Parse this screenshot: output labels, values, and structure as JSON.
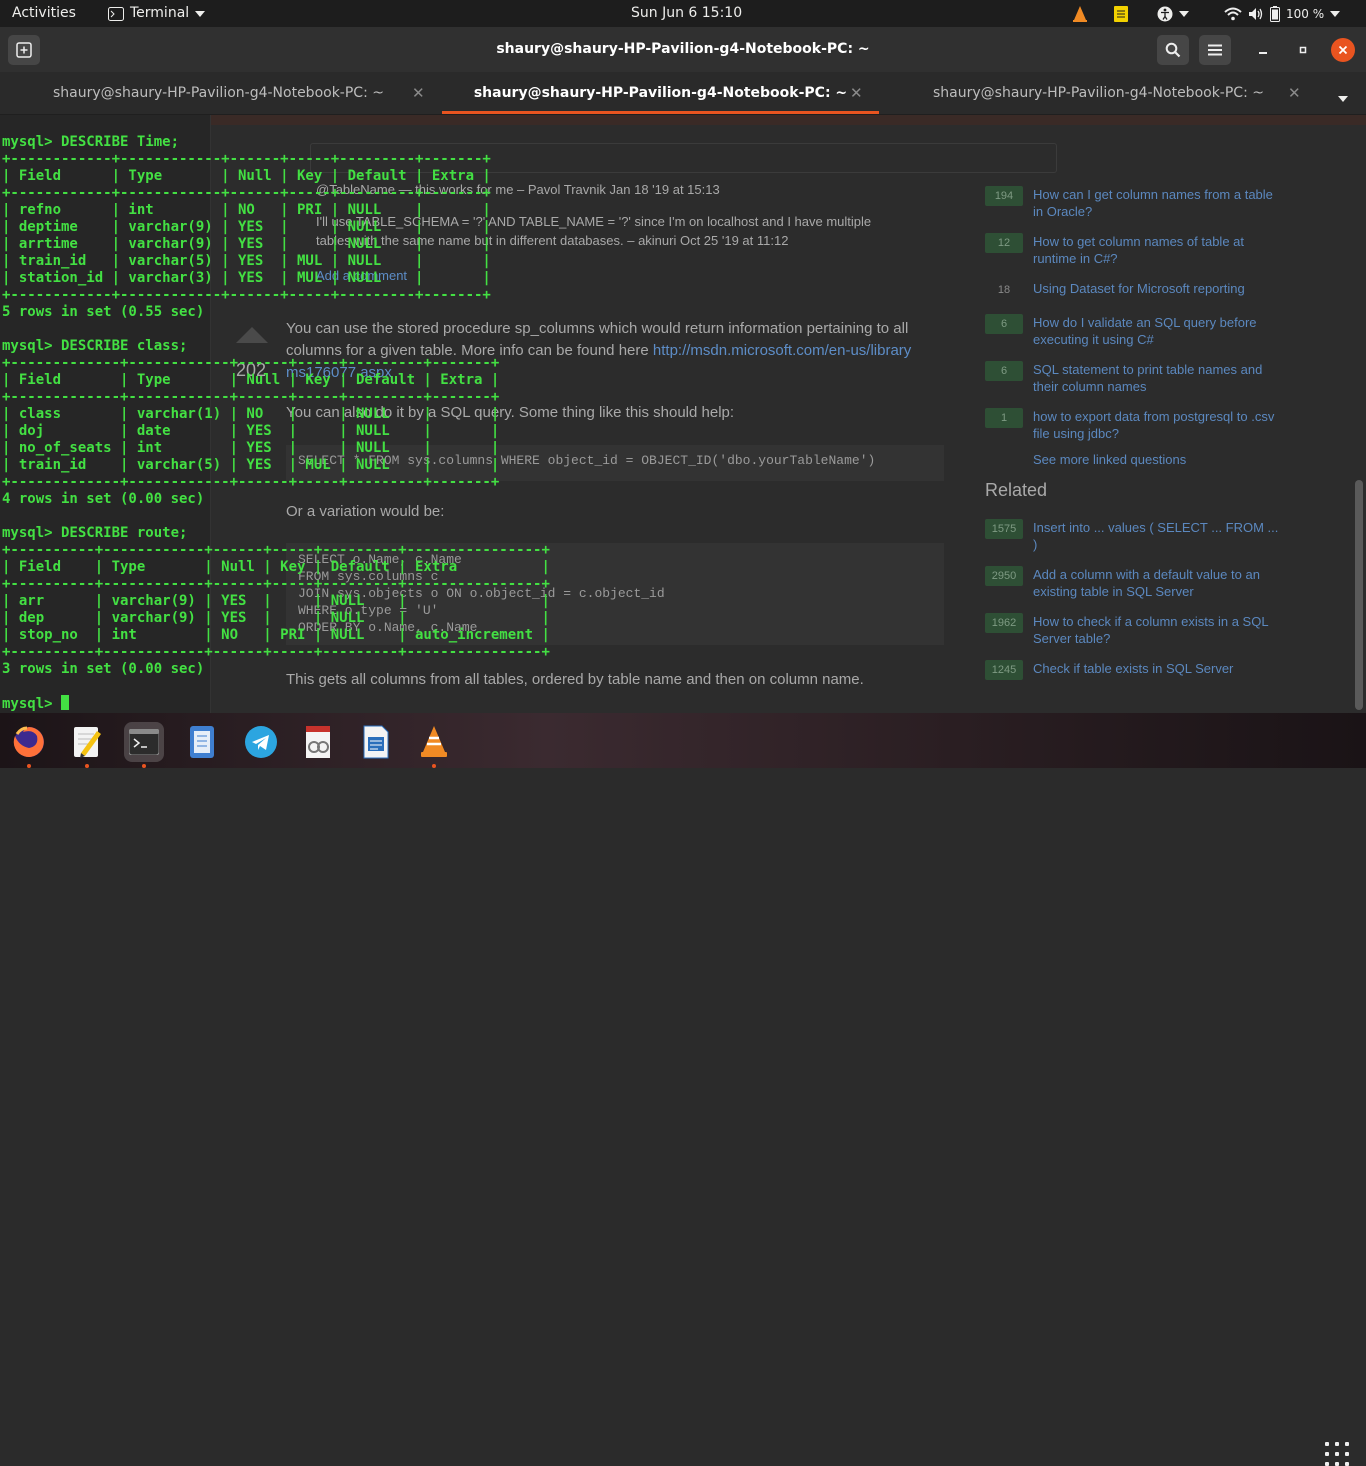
{
  "topbar": {
    "activities": "Activities",
    "app_menu": "Terminal",
    "clock": "Sun Jun 6  15:10",
    "battery": "100 %"
  },
  "window": {
    "title": "shaury@shaury-HP-Pavilion-g4-Notebook-PC: ~"
  },
  "tabs": [
    {
      "label": "shaury@shaury-HP-Pavilion-g4-Notebook-PC: ~",
      "active": false
    },
    {
      "label": "shaury@shaury-HP-Pavilion-g4-Notebook-PC: ~",
      "active": true
    },
    {
      "label": "shaury@shaury-HP-Pavilion-g4-Notebook-PC: ~",
      "active": false
    }
  ],
  "terminal": {
    "lines": [
      "mysql> DESCRIBE Time;",
      "+------------+------------+------+-----+---------+-------+",
      "| Field      | Type       | Null | Key | Default | Extra |",
      "+------------+------------+------+-----+---------+-------+",
      "| refno      | int        | NO   | PRI | NULL    |       |",
      "| deptime    | varchar(9) | YES  |     | NULL    |       |",
      "| arrtime    | varchar(9) | YES  |     | NULL    |       |",
      "| train_id   | varchar(5) | YES  | MUL | NULL    |       |",
      "| station_id | varchar(3) | YES  | MUL | NULL    |       |",
      "+------------+------------+------+-----+---------+-------+",
      "5 rows in set (0.55 sec)",
      "",
      "mysql> DESCRIBE class;",
      "+-------------+------------+------+-----+---------+-------+",
      "| Field       | Type       | Null | Key | Default | Extra |",
      "+-------------+------------+------+-----+---------+-------+",
      "| class       | varchar(1) | NO   |     | NULL    |       |",
      "| doj         | date       | YES  |     | NULL    |       |",
      "| no_of_seats | int        | YES  |     | NULL    |       |",
      "| train_id    | varchar(5) | YES  | MUL | NULL    |       |",
      "+-------------+------------+------+-----+---------+-------+",
      "4 rows in set (0.00 sec)",
      "",
      "mysql> DESCRIBE route;",
      "+----------+------------+------+-----+---------+----------------+",
      "| Field    | Type       | Null | Key | Default | Extra          |",
      "+----------+------------+------+-----+---------+----------------+",
      "| arr      | varchar(9) | YES  |     | NULL    |                |",
      "| dep      | varchar(9) | YES  |     | NULL    |                |",
      "| stop_no  | int        | NO   | PRI | NULL    | auto_increment |",
      "+----------+------------+------+-----+---------+----------------+",
      "3 rows in set (0.00 sec)",
      "",
      "mysql> "
    ],
    "color": "#43e043"
  },
  "background_page": {
    "comment_1": "@TableName — this works for me – Pavol Travnik Jan 18 '19 at 15:13",
    "comment_2_a": "I'll use  TABLE_SCHEMA = '?' AND TABLE_NAME = '?'  since I'm on localhost and I have multiple",
    "comment_2_b": "tables with the same name but in different databases. – akinuri Oct 25 '19 at 11:12",
    "add_comment": "Add a comment",
    "vote_count": "202",
    "answer_p1": "You can use the stored procedure sp_columns which would return information pertaining to all",
    "answer_p2_text": "columns for a given table. More info can be found here ",
    "answer_p2_link": "http://msdn.microsoft.com/en-us/library",
    "answer_p3": "ms176077.aspx",
    "answer_p4": "You can also do it by a SQL query. Some thing like this should help:",
    "code_1": "SELECT * FROM sys.columns WHERE object_id = OBJECT_ID('dbo.yourTableName')",
    "variation": "Or a variation would be:",
    "code_2": [
      "SELECT   o.Name, c.Name",
      "FROM     sys.columns c",
      "         JOIN sys.objects o ON o.object_id = c.object_id",
      "WHERE    o.type = 'U'",
      "ORDER BY o.Name, c.Name"
    ],
    "summary": "This gets all columns from all tables, ordered by table name and then on column name.",
    "linked": [
      {
        "count": "194",
        "text": "How can I get column names from a table in Oracle?"
      },
      {
        "count": "12",
        "text": "How to get column names of table at runtime in C#?"
      },
      {
        "count": "18",
        "text": "Using Dataset for Microsoft reporting"
      },
      {
        "count": "6",
        "text": "How do I validate an SQL query before executing it using C#"
      },
      {
        "count": "6",
        "text": "SQL statement to print table names and their column names"
      },
      {
        "count": "1",
        "text": "how to export data from postgresql to .csv file using jdbc?"
      }
    ],
    "see_more": "See more linked questions",
    "related_heading": "Related",
    "related": [
      {
        "count": "1575",
        "text": "Insert into ... values ( SELECT ... FROM ... )"
      },
      {
        "count": "2950",
        "text": "Add a column with a default value to an existing table in SQL Server"
      },
      {
        "count": "1962",
        "text": "How to check if a column exists in a SQL Server table?"
      },
      {
        "count": "1245",
        "text": "Check if table exists in SQL Server"
      }
    ]
  },
  "dock": {
    "apps": [
      "firefox-icon",
      "text-editor-icon",
      "terminal-icon",
      "notes-icon",
      "telegram-icon",
      "document-viewer-icon",
      "writer-icon",
      "vlc-icon"
    ]
  }
}
